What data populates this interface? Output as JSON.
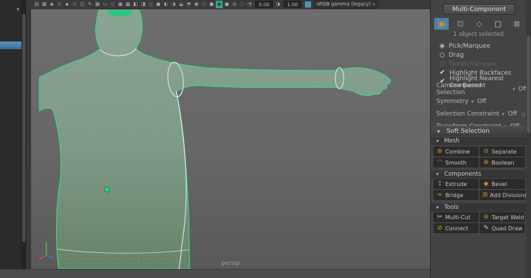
{
  "colors": {
    "accent_orange": "#d08a2e",
    "selection_blue": "#4d80ab",
    "wire_green": "#2fd48c",
    "viewport_bg": "#676767",
    "panel_bg": "#434343",
    "button_bg": "#2b2b2b",
    "toolbar_active_teal": "#3fa08c"
  },
  "viewport": {
    "camera_label": "persp",
    "toolbar": {
      "exposure_value": "0.00",
      "gamma_value": "1.00",
      "view_transform": "sRGB gamma (legacy)",
      "icons": [
        {
          "name": "panel-layout-icon",
          "glyph": "▤"
        },
        {
          "name": "select-camera-icon",
          "glyph": "▦"
        },
        {
          "name": "lock-camera-icon",
          "glyph": "▪"
        },
        {
          "name": "camera-attributes-icon",
          "glyph": "▫"
        },
        {
          "name": "bookmarks-icon",
          "glyph": "▪"
        },
        {
          "name": "image-plane-icon",
          "glyph": "▫"
        },
        {
          "name": "two-d-pan-zoom-icon",
          "glyph": "◫"
        },
        {
          "name": "grease-pencil-icon",
          "glyph": "✎"
        },
        {
          "name": "grid-icon",
          "glyph": "▦"
        },
        {
          "name": "film-gate-icon",
          "glyph": "▭"
        },
        {
          "name": "resolution-gate-icon",
          "glyph": "▯"
        },
        {
          "name": "gate-mask-icon",
          "glyph": "▣"
        },
        {
          "name": "field-chart-icon",
          "glyph": "▩"
        },
        {
          "name": "safe-action-icon",
          "glyph": "◧"
        },
        {
          "name": "safe-title-icon",
          "glyph": "◨"
        },
        {
          "name": "frame-all-icon",
          "glyph": "◻"
        },
        {
          "name": "frame-selected-icon",
          "glyph": "◼"
        },
        {
          "name": "lighting-icon",
          "glyph": "◐"
        },
        {
          "name": "shadows-icon",
          "glyph": "◑"
        },
        {
          "name": "ambient-occlusion-icon",
          "glyph": "◒"
        },
        {
          "name": "motion-blur-icon",
          "glyph": "◓"
        },
        {
          "name": "multisample-aa-icon",
          "glyph": "◉"
        },
        {
          "name": "wireframe-icon",
          "glyph": "○"
        },
        {
          "name": "smooth-shade-icon",
          "glyph": "●"
        },
        {
          "name": "wireframe-on-shaded-icon",
          "glyph": "◉",
          "active": true
        },
        {
          "name": "textured-icon",
          "glyph": "●"
        },
        {
          "name": "use-default-material-icon",
          "glyph": "◎"
        },
        {
          "name": "xray-icon",
          "glyph": "◌"
        }
      ]
    }
  },
  "toolkit": {
    "mode_button": "Multi-Component",
    "status_text": "1 object selected",
    "component_modes": [
      {
        "name": "object-mode-icon",
        "glyph": "▣",
        "active": true
      },
      {
        "name": "vertex-mode-icon",
        "glyph": "⊡",
        "active": false
      },
      {
        "name": "edge-mode-icon",
        "glyph": "◇",
        "active": false
      },
      {
        "name": "face-mode-icon",
        "glyph": "▢",
        "active": false
      },
      {
        "name": "uv-mode-icon",
        "glyph": "⊠",
        "active": false
      }
    ],
    "radios": [
      {
        "label": "Pick/Marquee",
        "selected": true,
        "enabled": true
      },
      {
        "label": "Drag",
        "selected": false,
        "enabled": true
      },
      {
        "label": "Tweak/Marquee",
        "selected": false,
        "enabled": false
      }
    ],
    "checkboxes": [
      {
        "label": "Highlight Backfaces",
        "checked": true,
        "glyph": "✔"
      },
      {
        "label": "Highlight Nearest Component",
        "checked": true,
        "glyph": "✔"
      }
    ],
    "dropdown_rows": [
      {
        "label": "Camera Based Selection",
        "caret": "▾",
        "value": "Off"
      },
      {
        "label": "Symmetry",
        "caret": "▾",
        "value": "Off"
      },
      {
        "label": "Selection Constraint",
        "caret": "▾",
        "value": "Off"
      },
      {
        "label": "Transform Constraint",
        "caret": "▾",
        "value": "Off"
      }
    ],
    "soft_selection": {
      "caret": "▸",
      "label": "Soft Selection"
    },
    "sections": [
      {
        "caret": "▾",
        "label": "Mesh",
        "buttons": [
          {
            "label": "Combine",
            "icon": "combine-icon",
            "glyph": "⊕"
          },
          {
            "label": "Separate",
            "icon": "separate-icon",
            "glyph": "⊖"
          },
          {
            "label": "Smooth",
            "icon": "smooth-icon",
            "glyph": "◠"
          },
          {
            "label": "Boolean",
            "icon": "boolean-icon",
            "glyph": "⊗"
          }
        ]
      },
      {
        "caret": "▾",
        "label": "Components",
        "buttons": [
          {
            "label": "Extrude",
            "icon": "extrude-icon",
            "glyph": "↥"
          },
          {
            "label": "Bevel",
            "icon": "bevel-icon",
            "glyph": "◆"
          },
          {
            "label": "Bridge",
            "icon": "bridge-icon",
            "glyph": "≍"
          },
          {
            "label": "Add Divisions",
            "icon": "add-divisions-icon",
            "glyph": "⊞"
          }
        ]
      },
      {
        "caret": "▾",
        "label": "Tools",
        "buttons": [
          {
            "label": "Multi-Cut",
            "icon": "multi-cut-icon",
            "glyph": "✂"
          },
          {
            "label": "Target Weld",
            "icon": "target-weld-icon",
            "glyph": "⊚"
          },
          {
            "label": "Connect",
            "icon": "connect-icon",
            "glyph": "⊘"
          },
          {
            "label": "Quad Draw",
            "icon": "quad-draw-icon",
            "glyph": "✎"
          }
        ]
      }
    ]
  }
}
